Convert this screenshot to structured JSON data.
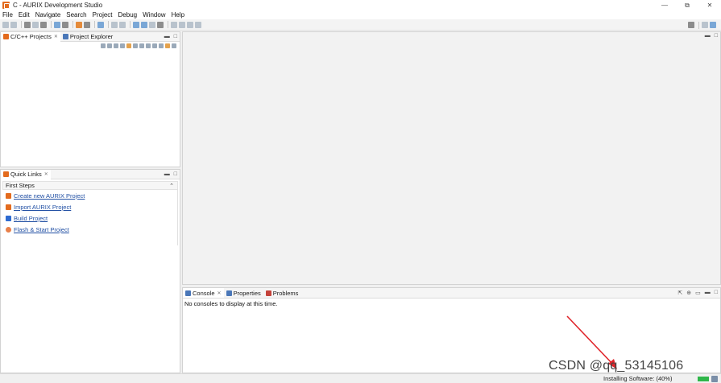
{
  "window": {
    "title": "C - AURIX Development Studio",
    "controls": {
      "minimize": "—",
      "restore": "⧉",
      "close": "✕"
    }
  },
  "menubar": {
    "items": [
      "File",
      "Edit",
      "Navigate",
      "Search",
      "Project",
      "Debug",
      "Window",
      "Help"
    ]
  },
  "left_top_panel": {
    "tabs": [
      {
        "label": "C/C++ Projects",
        "close": "✕"
      },
      {
        "label": "Project Explorer"
      }
    ]
  },
  "quick_links": {
    "tab_label": "Quick Links",
    "close": "✕",
    "section_title": "First Steps",
    "links": [
      {
        "label": "Create new AURIX Project",
        "icon": "aurix-new-project-icon"
      },
      {
        "label": "Import AURIX Project",
        "icon": "aurix-import-icon"
      },
      {
        "label": "Build Project",
        "icon": "hammer-icon"
      },
      {
        "label": "Flash & Start Project",
        "icon": "flash-icon"
      }
    ]
  },
  "bottom_panel": {
    "tabs": [
      {
        "label": "Console",
        "close": "✕"
      },
      {
        "label": "Properties"
      },
      {
        "label": "Problems"
      }
    ],
    "message": "No consoles to display at this time."
  },
  "statusbar": {
    "text": "Installing Software: (40%)",
    "progress_percent": 40
  },
  "watermark": "CSDN @qq_53145106",
  "colors": {
    "accent": "#e36b1e",
    "link": "#1f4ea3",
    "progress": "#2fb64a",
    "arrow": "#e0242a"
  }
}
